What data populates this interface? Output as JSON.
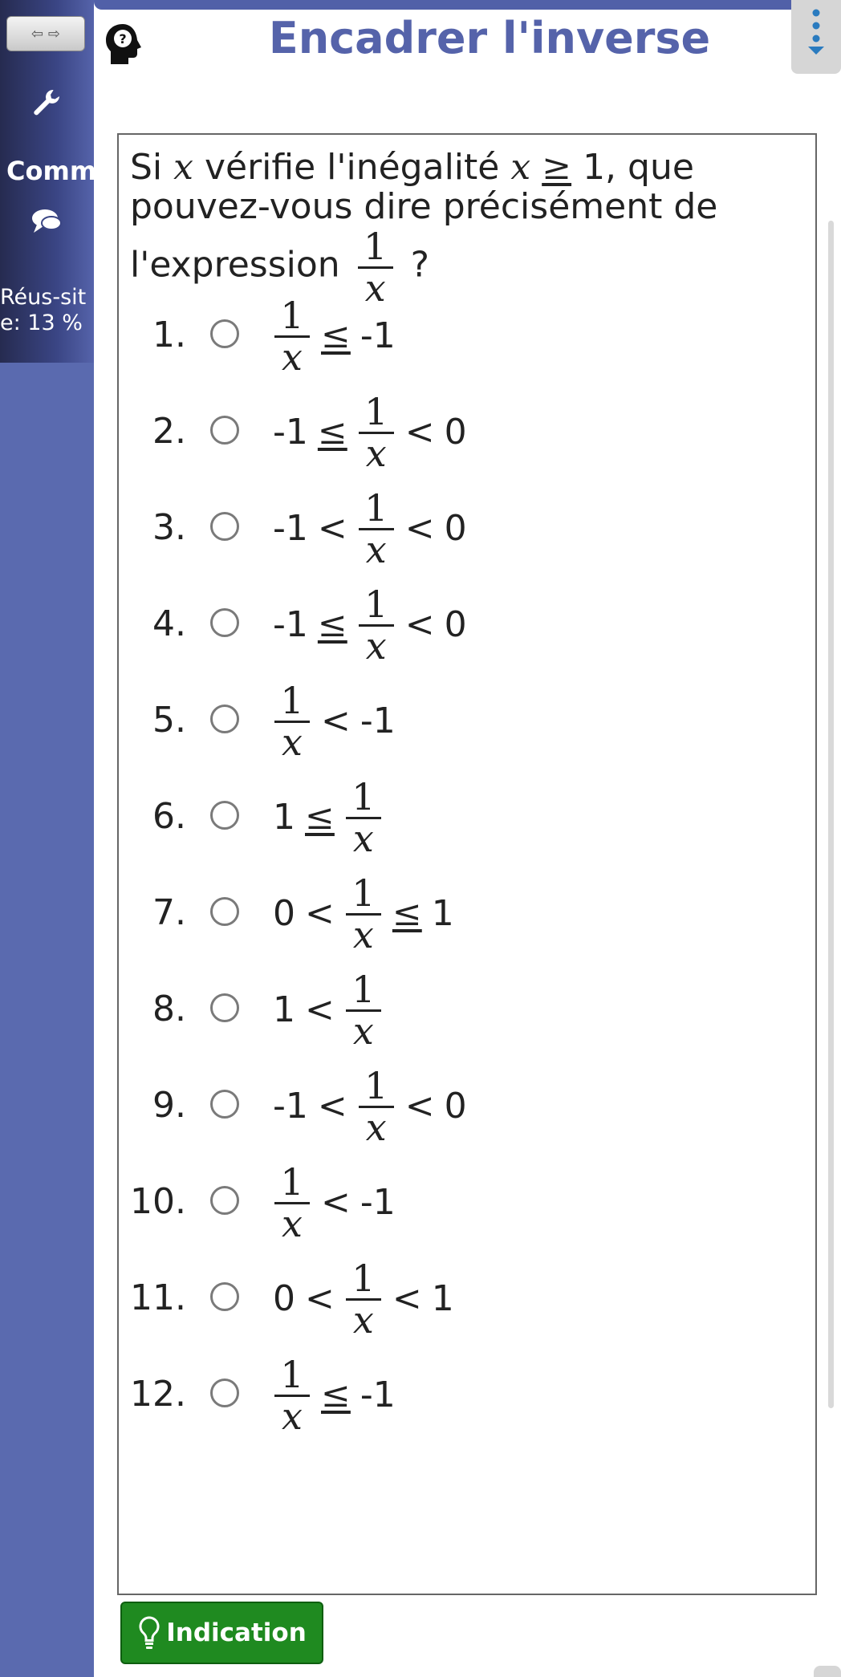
{
  "sidebar": {
    "nav_label": "⇦ ⇨",
    "section_label": "Comm",
    "score_text": "Réus-site: 13 %"
  },
  "header": {
    "title": "Encadrer l'inverse"
  },
  "question": {
    "prefix": "Si",
    "var": "x",
    "mid": "vérifie l'inégalité",
    "relation": "≥",
    "bound": "1, que pouvez-vous dire précisément de l'expression",
    "suffix": "?",
    "frac_num": "1",
    "frac_den": "x"
  },
  "choices": [
    {
      "num": "1.",
      "left": "",
      "op1": "",
      "op2": "≤",
      "right": "-1"
    },
    {
      "num": "2.",
      "left": "-1",
      "op1": "≤",
      "op2": "<",
      "right": "0"
    },
    {
      "num": "3.",
      "left": "-1",
      "op1": "<",
      "op2": "<",
      "right": "0"
    },
    {
      "num": "4.",
      "left": "-1",
      "op1": "≤",
      "op2": "<",
      "right": "0"
    },
    {
      "num": "5.",
      "left": "",
      "op1": "",
      "op2": "<",
      "right": "-1"
    },
    {
      "num": "6.",
      "left": "1",
      "op1": "≤",
      "op2": "",
      "right": ""
    },
    {
      "num": "7.",
      "left": "0",
      "op1": "<",
      "op2": "≤",
      "right": "1"
    },
    {
      "num": "8.",
      "left": "1",
      "op1": "<",
      "op2": "",
      "right": ""
    },
    {
      "num": "9.",
      "left": "-1",
      "op1": "<",
      "op2": "<",
      "right": "0"
    },
    {
      "num": "10.",
      "left": "",
      "op1": "",
      "op2": "<",
      "right": "-1"
    },
    {
      "num": "11.",
      "left": "0",
      "op1": "<",
      "op2": "<",
      "right": "1"
    },
    {
      "num": "12.",
      "left": "",
      "op1": "",
      "op2": "≤",
      "right": "-1"
    }
  ],
  "hint_button": {
    "label": "Indication"
  }
}
